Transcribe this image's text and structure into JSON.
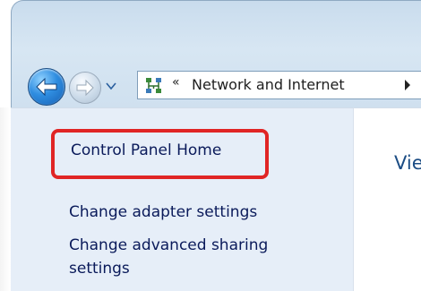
{
  "navigation": {
    "back_icon": "back-arrow-icon",
    "forward_icon": "forward-arrow-icon",
    "history_icon": "chevron-down-icon"
  },
  "address_bar": {
    "location_icon": "network-icon",
    "overflow_chevrons": "«",
    "breadcrumb": "Network and Internet",
    "separator_icon": "chevron-right-icon"
  },
  "left_pane": {
    "control_panel_home": "Control Panel Home",
    "links": [
      {
        "label": "Change adapter settings"
      },
      {
        "label_line1": "Change advanced sharing",
        "label_line2": "settings"
      }
    ],
    "highlight_color": "#e02525"
  },
  "content": {
    "heading_partial": "Vie"
  },
  "colors": {
    "link": "#0a1a5a",
    "heading": "#1b4c84",
    "pane_background": "#e6eef8"
  }
}
